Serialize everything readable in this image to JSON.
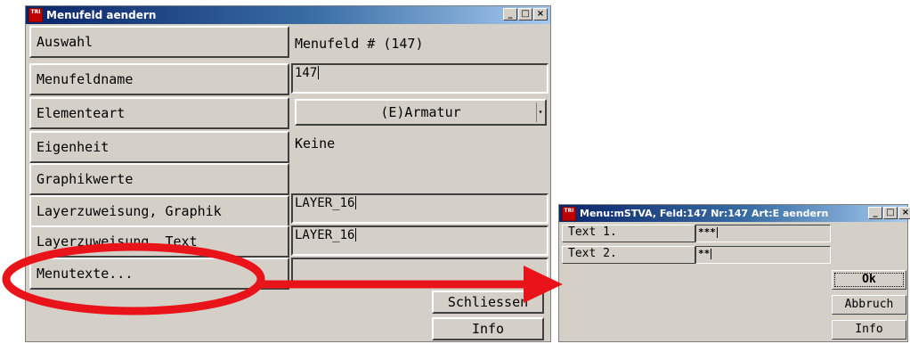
{
  "main_window": {
    "title": "Menufeld aendern",
    "icon_text": "TRI",
    "controls": [
      "_",
      "□",
      "×"
    ],
    "rows": {
      "auswahl_label": "Auswahl",
      "auswahl_value": "Menufeld #  (147)",
      "menufeldname_label": "Menufeldname",
      "menufeldname_value": "147",
      "elementeart_label": "Elementeart",
      "elementeart_value": "(E)Armatur",
      "eigenheit_label": "Eigenheit",
      "eigenheit_value": "Keine",
      "graphikwerte_label": "Graphikwerte",
      "layer_graphik_label": "Layerzuweisung, Graphik",
      "layer_graphik_value": "LAYER_16",
      "layer_text_label": "Layerzuweisung, Text",
      "layer_text_value": "LAYER_16",
      "menutexte_label": "Menutexte..."
    },
    "buttons": {
      "schliessen": "Schliessen",
      "info": "Info"
    }
  },
  "sub_window": {
    "title": "Menu:mSTVA, Feld:147 Nr:147 Art:E aendern",
    "icon_text": "TRI",
    "controls": [
      "_",
      "□",
      "×"
    ],
    "rows": [
      {
        "label": "Text  1.",
        "value": "***"
      },
      {
        "label": "Text  2.",
        "value": "**"
      }
    ],
    "buttons": {
      "ok": "Ok",
      "abbruch": "Abbruch",
      "info": "Info"
    }
  },
  "annotation": {
    "color": "#e8141a"
  }
}
